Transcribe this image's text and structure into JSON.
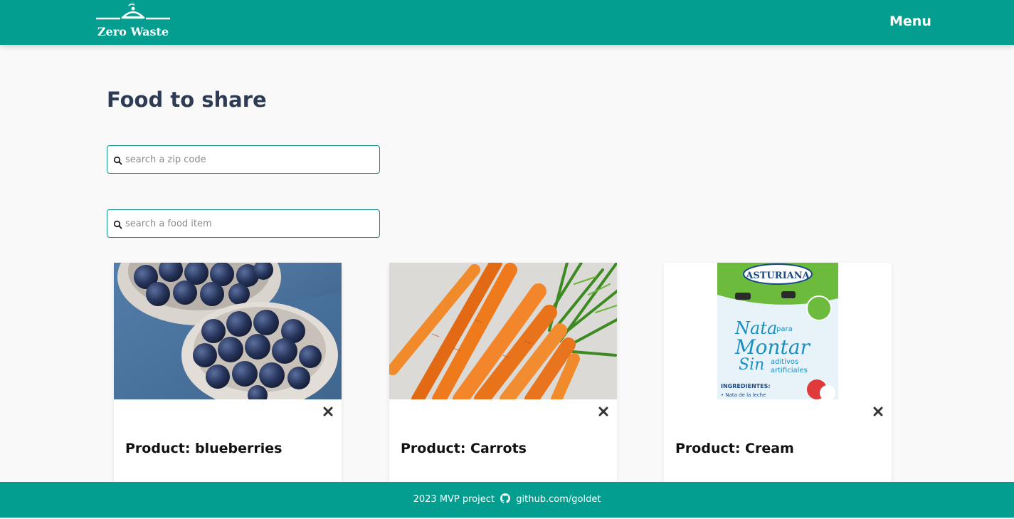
{
  "header": {
    "logo_text": "Zero Waste",
    "menu_label": "Menu"
  },
  "main": {
    "title": "Food to share",
    "zip_search": {
      "placeholder": "search a zip code",
      "value": ""
    },
    "food_search": {
      "placeholder": "search a food item",
      "value": ""
    }
  },
  "products": [
    {
      "title": "Product: blueberries",
      "image": "blueberries-photo"
    },
    {
      "title": "Product: Carrots",
      "image": "carrots-photo"
    },
    {
      "title": "Product: Cream",
      "image": "cream-carton-photo"
    }
  ],
  "cream_carton": {
    "brand": "ASTURIANA",
    "line1": "Nata",
    "line1b": "para",
    "line2": "Montar",
    "line3": "Sin",
    "line3b": "aditivos",
    "line3c": "artificiales",
    "ingredients": "INGREDIENTES:",
    "ingredients_line": "• Nata de la leche"
  },
  "footer": {
    "project_text": "2023 MVP project",
    "github_text": "github.com/goldet",
    "github_icon": "github-icon"
  },
  "colors": {
    "brand": "#049e90",
    "title": "#2d3b55",
    "background": "#f9f9f9"
  }
}
